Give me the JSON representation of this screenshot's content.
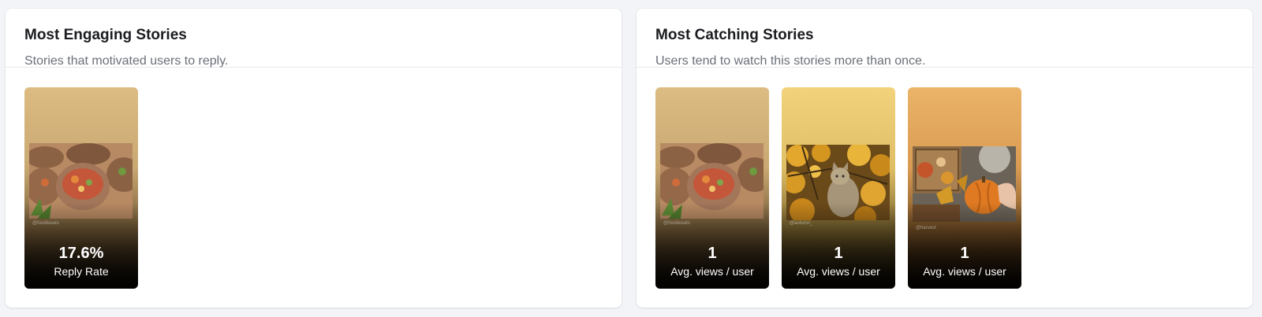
{
  "engaging": {
    "title": "Most Engaging Stories",
    "subtitle": "Stories that motivated users to reply.",
    "stories": [
      {
        "value": "17.6%",
        "label": "Reply Rate",
        "handle": "@foodieeats",
        "bg_top": "#dcbc82",
        "bg_mid": "#b89a66",
        "photo": "mushrooms"
      }
    ]
  },
  "catching": {
    "title": "Most Catching Stories",
    "subtitle": "Users tend to watch this stories more than once.",
    "stories": [
      {
        "value": "1",
        "label": "Avg. views / user",
        "handle": "@foodieeats",
        "bg_top": "#dcbc82",
        "bg_mid": "#b89a66",
        "photo": "mushrooms"
      },
      {
        "value": "1",
        "label": "Avg. views / user",
        "handle": "@autumn_",
        "bg_top": "#f2d37c",
        "bg_mid": "#c9aa55",
        "photo": "cat"
      },
      {
        "value": "1",
        "label": "Avg. views / user",
        "handle": "@harvest",
        "bg_top": "#ebb468",
        "bg_mid": "#c38a45",
        "photo": "pumpkin"
      }
    ]
  }
}
